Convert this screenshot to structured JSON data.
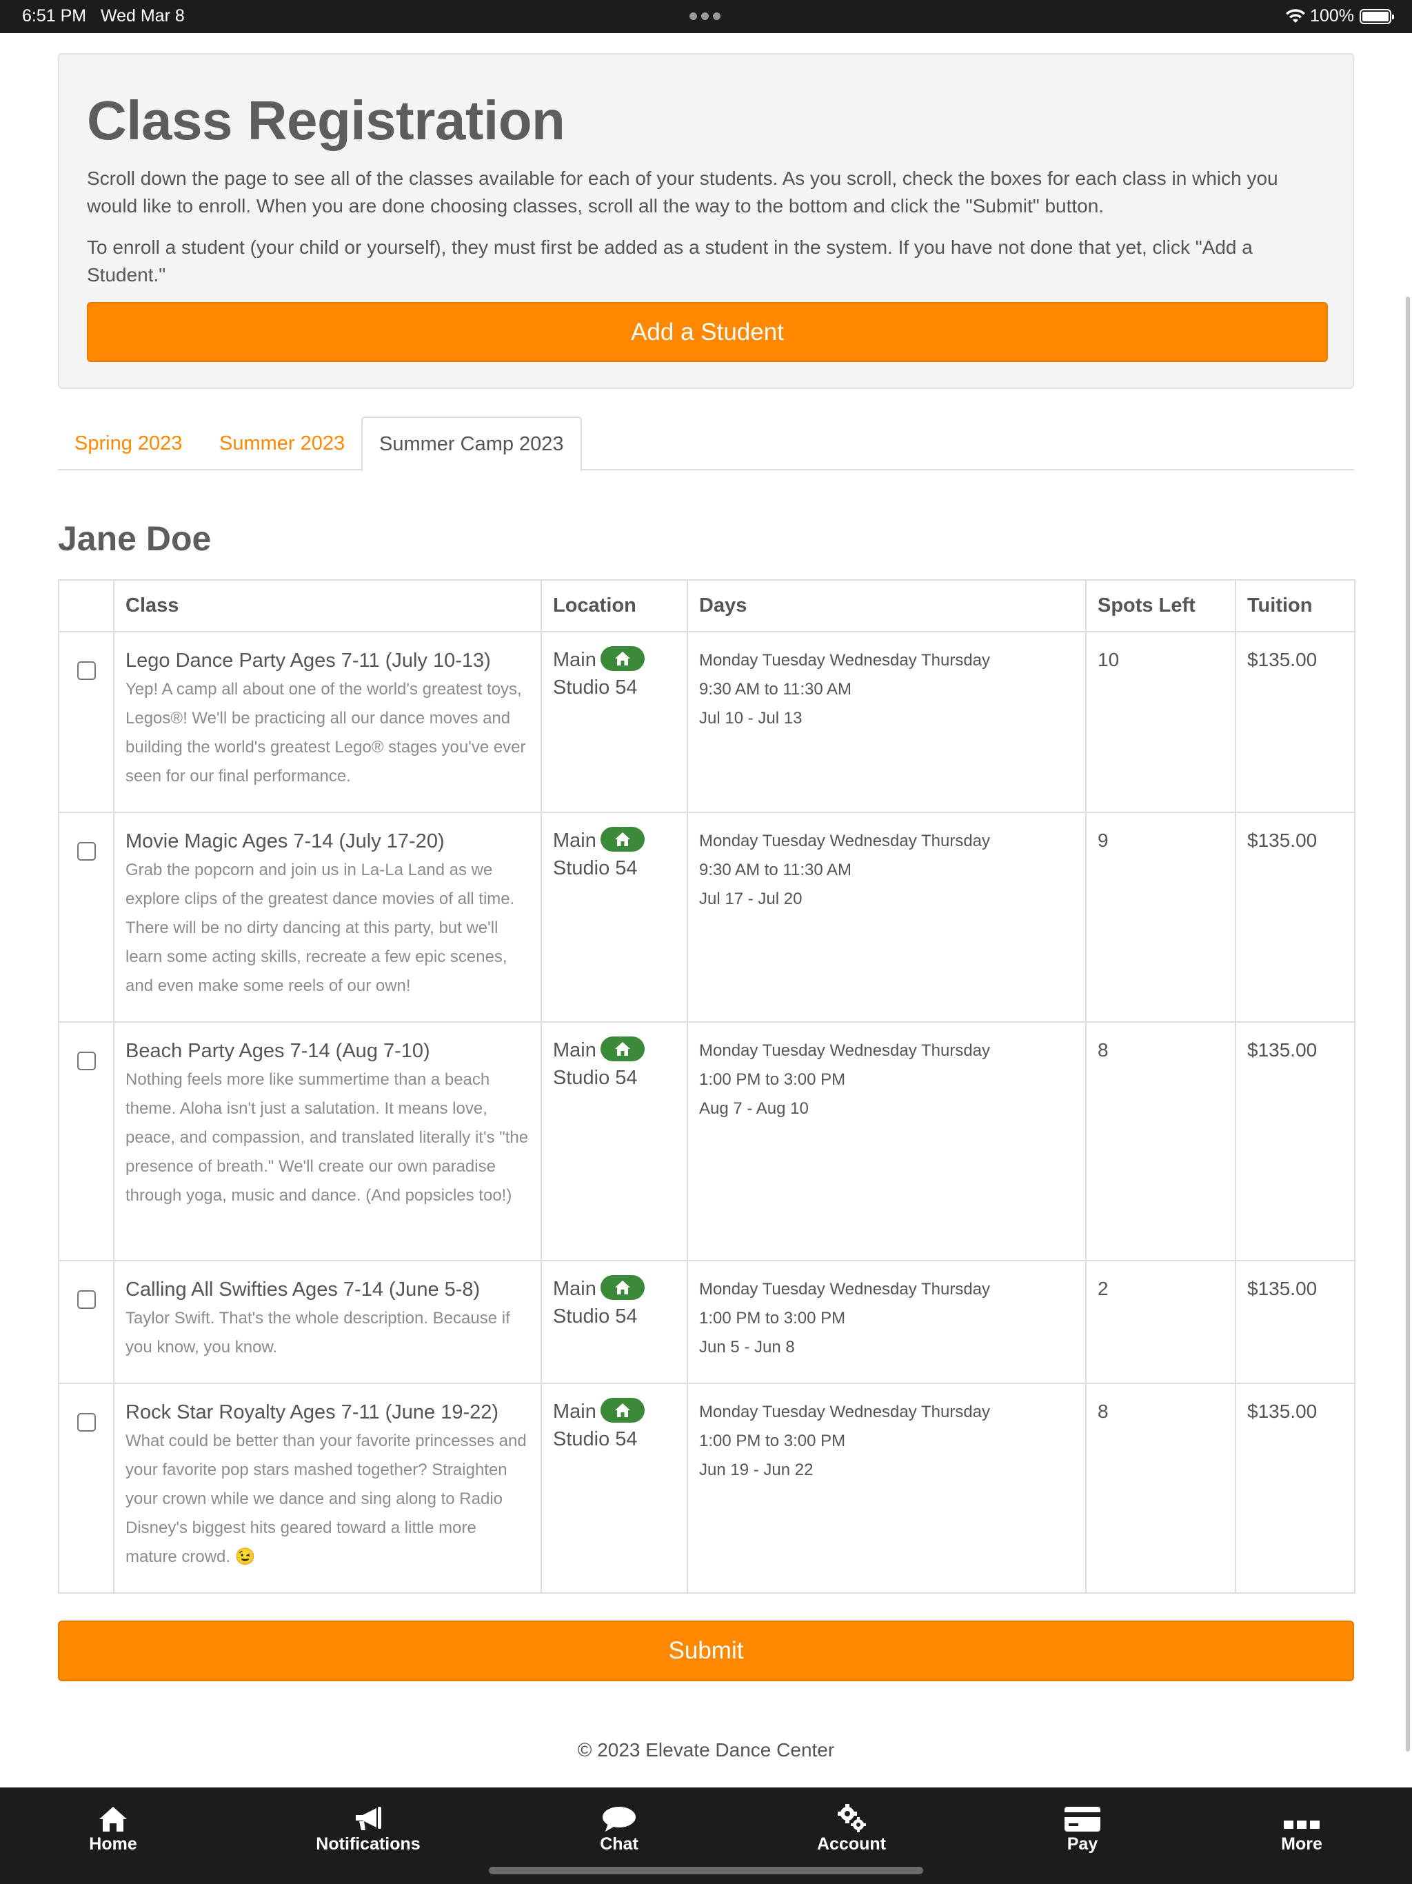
{
  "status_bar": {
    "time": "6:51 PM",
    "date": "Wed Mar 8",
    "battery": "100%"
  },
  "hero": {
    "title": "Class Registration",
    "paragraph1": "Scroll down the page to see all of the classes available for each of your students. As you scroll, check the boxes for each class in which you would like to enroll. When you are done choosing classes, scroll all the way to the bottom and click the \"Submit\" button.",
    "paragraph2": "To enroll a student (your child or yourself), they must first be added as a student in the system. If you have not done that yet, click \"Add a Student.\"",
    "add_button": "Add a Student"
  },
  "tabs": [
    {
      "label": "Spring 2023",
      "active": false
    },
    {
      "label": "Summer 2023",
      "active": false
    },
    {
      "label": "Summer Camp 2023",
      "active": true
    }
  ],
  "student_name": "Jane Doe",
  "table": {
    "headers": {
      "class": "Class",
      "location": "Location",
      "days": "Days",
      "spots": "Spots Left",
      "tuition": "Tuition"
    },
    "rows": [
      {
        "name": "Lego Dance Party Ages 7-11 (July 10-13)",
        "description": "Yep! A camp all about one of the world's greatest toys, Legos®! We'll be practicing all our dance moves and building the world's greatest Lego® stages you've ever seen for our final performance.",
        "location_line1": "Main",
        "location_line2": "Studio 54",
        "days": "Monday Tuesday Wednesday Thursday",
        "time": "9:30 AM to 11:30 AM",
        "dates": "Jul 10 - Jul 13",
        "spots": "10",
        "tuition": "$135.00"
      },
      {
        "name": "Movie Magic Ages 7-14 (July 17-20)",
        "description": "Grab the popcorn and join us in La-La Land as we explore clips of the greatest dance movies of all time. There will be no dirty dancing at this party, but we'll learn some acting skills, recreate a few epic scenes, and even make some reels of our own!",
        "location_line1": "Main",
        "location_line2": "Studio 54",
        "days": "Monday Tuesday Wednesday Thursday",
        "time": "9:30 AM to 11:30 AM",
        "dates": "Jul 17 - Jul 20",
        "spots": "9",
        "tuition": "$135.00"
      },
      {
        "name": "Beach Party Ages 7-14 (Aug 7-10)",
        "description": "Nothing feels more like summertime than a beach theme. Aloha isn't just a salutation. It means love, peace, and compassion, and translated literally it's \"the presence of breath.\" We'll create our own paradise through yoga, music and dance. (And popsicles too!)",
        "location_line1": "Main",
        "location_line2": "Studio 54",
        "days": "Monday Tuesday Wednesday Thursday",
        "time": "1:00 PM to 3:00 PM",
        "dates": "Aug 7 - Aug 10",
        "spots": "8",
        "tuition": "$135.00"
      },
      {
        "name": "Calling All Swifties Ages 7-14 (June 5-8)",
        "description": "Taylor Swift. That's the whole description. Because if you know, you know.",
        "location_line1": "Main",
        "location_line2": "Studio 54",
        "days": "Monday Tuesday Wednesday Thursday",
        "time": "1:00 PM to 3:00 PM",
        "dates": "Jun 5 - Jun 8",
        "spots": "2",
        "tuition": "$135.00"
      },
      {
        "name": "Rock Star Royalty Ages 7-11 (June 19-22)",
        "description": "What could be better than your favorite princesses and your favorite pop stars mashed together? Straighten your crown while we dance and sing along to Radio Disney's biggest hits geared toward a little more mature crowd. 😉",
        "location_line1": "Main",
        "location_line2": "Studio 54",
        "days": "Monday Tuesday Wednesday Thursday",
        "time": "1:00 PM to 3:00 PM",
        "dates": "Jun 19 - Jun 22",
        "spots": "8",
        "tuition": "$135.00"
      }
    ]
  },
  "submit_button": "Submit",
  "footer": "© 2023 Elevate Dance Center",
  "bottom_nav": [
    {
      "label": "Home",
      "icon": "home-icon"
    },
    {
      "label": "Notifications",
      "icon": "megaphone-icon"
    },
    {
      "label": "Chat",
      "icon": "chat-bubble-icon"
    },
    {
      "label": "Account",
      "icon": "gears-icon"
    },
    {
      "label": "Pay",
      "icon": "credit-card-icon"
    },
    {
      "label": "More",
      "icon": "more-dots-icon"
    }
  ],
  "colors": {
    "accent": "#ff8800",
    "location_badge": "#3a8a3a",
    "nav_background": "#1c1c1c"
  }
}
